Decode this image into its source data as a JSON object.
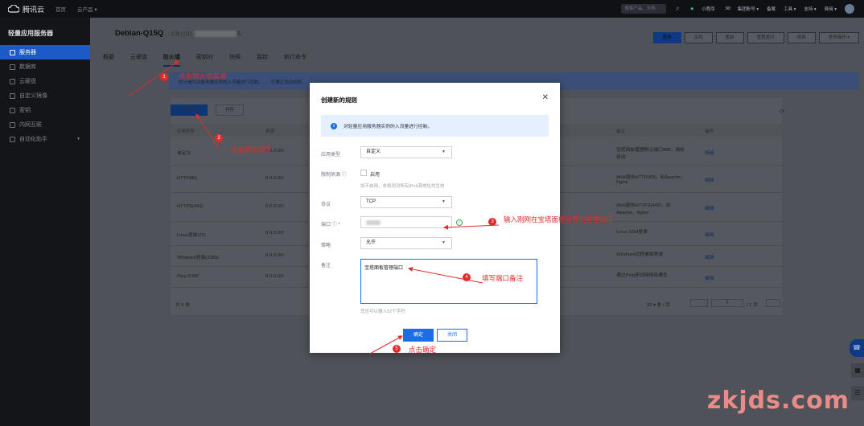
{
  "topbar": {
    "brand": "腾讯云",
    "links": [
      "首页",
      "云产品 ▾"
    ],
    "search_placeholder": "搜索产品、文档",
    "items": [
      "小程序",
      "集团账号 ▾",
      "备案",
      "工具 ▾",
      "支持 ▾",
      "费用 ▾"
    ]
  },
  "sidebar": {
    "title": "轻量应用服务器",
    "items": [
      {
        "label": "服务器",
        "active": true
      },
      {
        "label": "数据库",
        "active": false
      },
      {
        "label": "云硬盘",
        "active": false
      },
      {
        "label": "自定义镜像",
        "active": false
      },
      {
        "label": "密钥",
        "active": false
      },
      {
        "label": "内网互联",
        "active": false
      },
      {
        "label": "自动化助手",
        "active": false
      }
    ]
  },
  "page": {
    "instance_name": "Debian-Q15Q",
    "region_prefix": "上海 | (公)",
    "region_suffix": "右",
    "actions": [
      "登录",
      "关机",
      "重启",
      "重置密码",
      "续费",
      "更多操作 ▾"
    ],
    "tabs": [
      "概要",
      "云硬盘",
      "防火墙",
      "密钥对",
      "快照",
      "监控",
      "执行命令"
    ],
    "active_tab": "防火墙",
    "notice": "防火墙可对服务器实例的入流量进行控制，...，可通过添加规则...",
    "add_rule_button": "添加规则",
    "sort_button": "排序",
    "table_headers": [
      "应用类型",
      "来源",
      "备注",
      "操作"
    ],
    "rows": [
      {
        "type": "自定义",
        "source": "0.0.0.0/0",
        "note": "宝塔面板管理默认端口888，面板修改",
        "op": "编辑"
      },
      {
        "type": "HTTP(80)",
        "source": "0.0.0.0/0",
        "note": "Web服务HTTP(80)，如Apache、Nginx",
        "op": "编辑"
      },
      {
        "type": "HTTPS(443)",
        "source": "0.0.0.0/0",
        "note": "Web服务HTTPS(443)，如Apache、Nginx",
        "op": "编辑"
      },
      {
        "type": "Linux登录(22)",
        "source": "0.0.0.0/0",
        "note": "Linux SSH登录",
        "op": "编辑"
      },
      {
        "type": "Windows登录(3389)",
        "source": "0.0.0.0/0",
        "note": "Windows远程桌面登录",
        "op": "编辑"
      },
      {
        "type": "Ping ICMP",
        "source": "0.0.0.0/0",
        "note": "通过Ping测试网络连通性",
        "op": "编辑"
      }
    ],
    "total": "共 6 条",
    "page_size": "20 ▾ 条 / 页",
    "page_num": "1",
    "page_total": "/ 1 页"
  },
  "modal": {
    "title": "创建新的规则",
    "info": "对轻量应用服务器实例的入流量进行控制。",
    "app_type_label": "应用类型",
    "app_type_value": "自定义",
    "limit_source_label": "限制来源",
    "enable_label": "启用",
    "limit_hint": "如不启用，本规则对所有IPv4源地址均生效",
    "protocol_label": "协议",
    "protocol_value": "TCP",
    "port_label": "端口 ⓘ *",
    "policy_label": "策略",
    "policy_value": "允许",
    "note_label": "备注",
    "note_value": "宝塔面板管理端口",
    "note_hint": "您还可以输入52个字符",
    "confirm": "确定",
    "cancel": "关闭"
  },
  "annotations": [
    {
      "num": "1",
      "text": "点击防火墙菜单"
    },
    {
      "num": "2",
      "text": "点击添加规则"
    },
    {
      "num": "3",
      "text": "输入刚刚在宝塔面板设置的管理端口"
    },
    {
      "num": "4",
      "text": "填写端口备注"
    },
    {
      "num": "5",
      "text": "点击确定"
    }
  ],
  "watermark": "zkjds.com",
  "colors": {
    "accent": "#1a6fe8",
    "annotation": "#e22c2c",
    "sidebar_active": "#1c5bc7"
  }
}
